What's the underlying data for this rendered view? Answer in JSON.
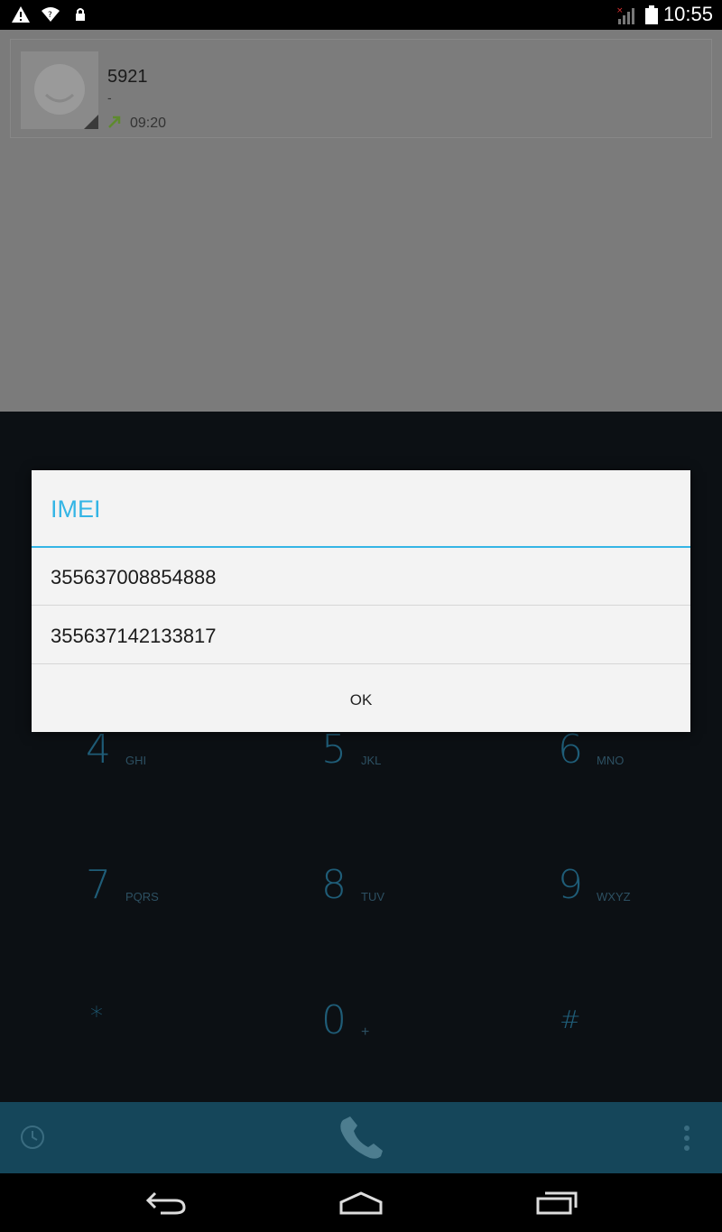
{
  "status_bar": {
    "time": "10:55",
    "icons": [
      "warning-icon",
      "wifi-icon",
      "lock-icon",
      "no-signal-icon",
      "battery-icon"
    ]
  },
  "call_log": {
    "entries": [
      {
        "name": "5921",
        "detail": "-",
        "time": "09:20",
        "direction_icon": "outgoing-call-arrow-icon"
      }
    ]
  },
  "dialpad": {
    "keys": [
      {
        "digit": "4",
        "letters": "GHI"
      },
      {
        "digit": "5",
        "letters": "JKL"
      },
      {
        "digit": "6",
        "letters": "MNO"
      },
      {
        "digit": "7",
        "letters": "PQRS"
      },
      {
        "digit": "8",
        "letters": "TUV"
      },
      {
        "digit": "9",
        "letters": "WXYZ"
      },
      {
        "digit": "*",
        "letters": ""
      },
      {
        "digit": "0",
        "letters": "+"
      },
      {
        "digit": "#",
        "letters": ""
      }
    ]
  },
  "dialog": {
    "title": "IMEI",
    "items": [
      "355637008854888",
      "355637142133817"
    ],
    "ok_label": "OK"
  },
  "colors": {
    "accent": "#34b5e5",
    "dial_bar": "#15465a",
    "dialog_bg": "#f3f3f3"
  }
}
